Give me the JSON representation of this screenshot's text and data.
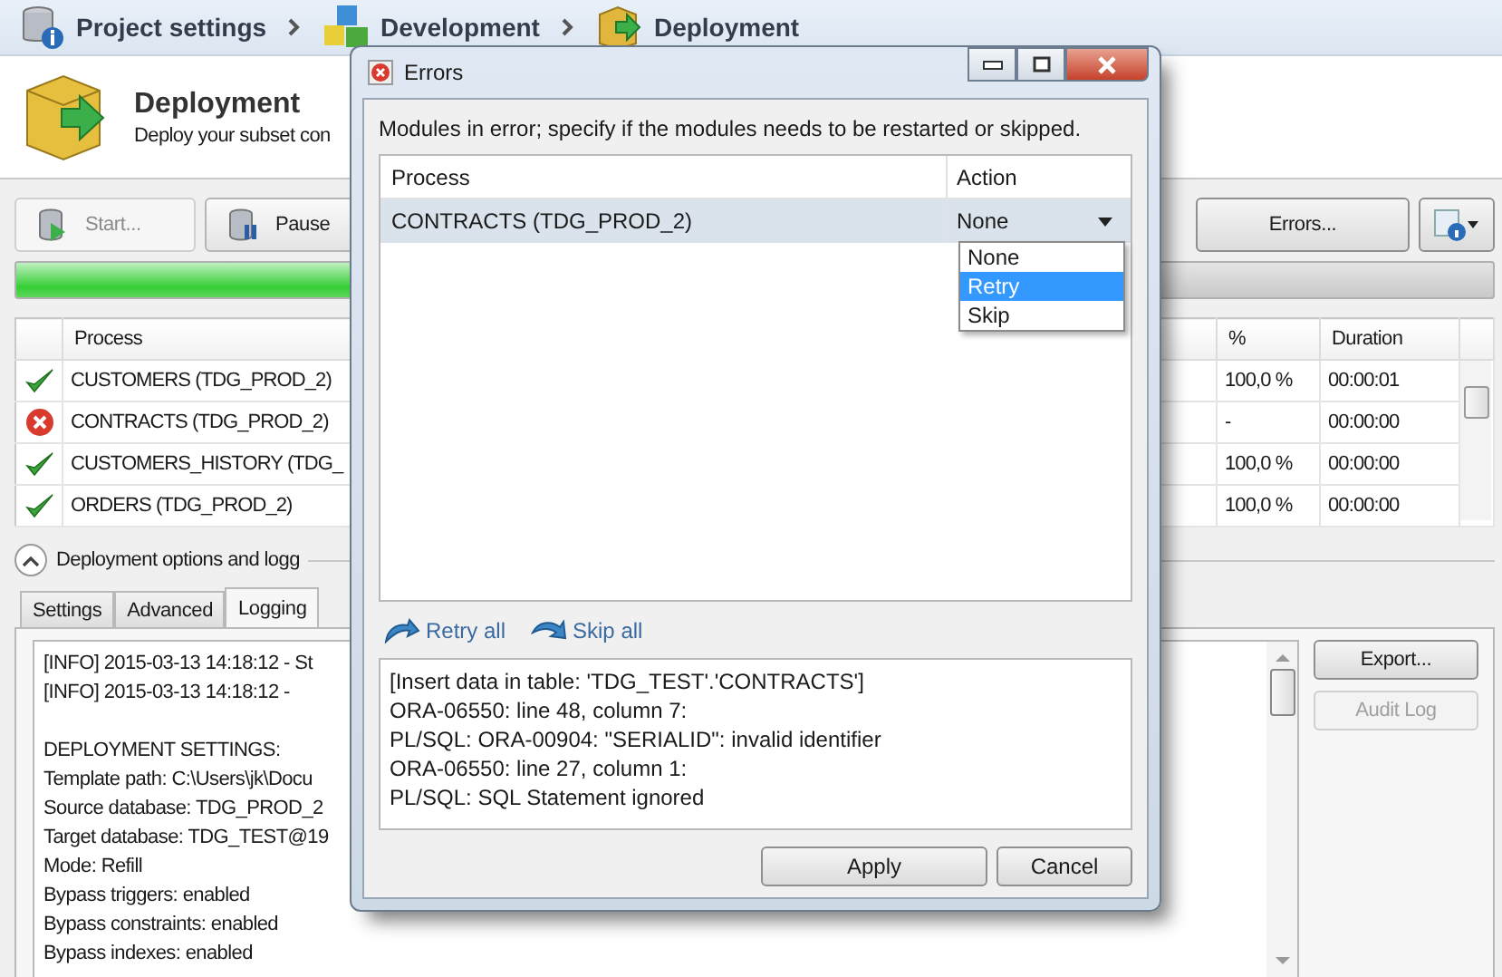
{
  "breadcrumb": [
    {
      "label": "Project settings"
    },
    {
      "label": "Development"
    },
    {
      "label": "Deployment"
    }
  ],
  "header": {
    "title": "Deployment",
    "subtitle": "Deploy your subset con"
  },
  "toolbar": {
    "buttons": [
      {
        "label": "Start...",
        "disabled": true
      },
      {
        "label": "Pause",
        "disabled": false
      }
    ],
    "errors_button": "Errors..."
  },
  "progress": {
    "level": 0.6
  },
  "processes": {
    "columns": {
      "process": "Process",
      "percent": "%",
      "duration": "Duration"
    },
    "rows": [
      {
        "kind": "ok",
        "process": "CUSTOMERS (TDG_PROD_2)",
        "percent": "100,0 %",
        "duration": "00:00:01"
      },
      {
        "kind": "error",
        "process": "CONTRACTS (TDG_PROD_2)",
        "percent": "-",
        "duration": "00:00:00"
      },
      {
        "kind": "ok",
        "process": "CUSTOMERS_HISTORY (TDG_",
        "percent": "100,0 %",
        "duration": "00:00:00"
      },
      {
        "kind": "ok",
        "process": "ORDERS (TDG_PROD_2)",
        "percent": "100,0 %",
        "duration": "00:00:00"
      }
    ]
  },
  "options_expander": {
    "label": "Deployment options and logg",
    "expanded": true
  },
  "tabs": [
    {
      "label": "Settings",
      "selected": false
    },
    {
      "label": "Advanced",
      "selected": false
    },
    {
      "label": "Logging",
      "selected": true
    }
  ],
  "log": {
    "blocks": [
      [
        "[INFO] 2015-03-13 14:18:12 - St",
        "[INFO] 2015-03-13 14:18:12 -"
      ],
      [
        "DEPLOYMENT SETTINGS:",
        "Template path: C:\\Users\\jk\\Docu",
        "Source database: TDG_PROD_2",
        "Target database: TDG_TEST@19",
        "Mode: Refill",
        "Bypass triggers: enabled",
        "Bypass constraints: enabled",
        "Bypass indexes: enabled"
      ]
    ],
    "buttons": [
      {
        "label": "Export...",
        "disabled": false
      },
      {
        "label": "Audit Log",
        "disabled": true
      }
    ]
  },
  "dialog": {
    "title": "Errors",
    "message": "Modules in error; specify if the modules needs to be restarted or skipped.",
    "columns": {
      "process": "Process",
      "action": "Action"
    },
    "rows": [
      {
        "process": "CONTRACTS (TDG_PROD_2)",
        "action": "None",
        "selected": true
      }
    ],
    "dropdown": {
      "options": [
        {
          "label": "None",
          "selected": false
        },
        {
          "label": "Retry",
          "selected": true
        },
        {
          "label": "Skip",
          "selected": false
        }
      ]
    },
    "links": [
      {
        "label": "Retry all",
        "kind": "retry"
      },
      {
        "label": "Skip all",
        "kind": "skip"
      }
    ],
    "details": [
      "[Insert data in table: 'TDG_TEST'.'CONTRACTS']",
      "ORA-06550: line 48, column 7:",
      "PL/SQL: ORA-00904: \"SERIALID\": invalid identifier",
      "ORA-06550: line 27, column 1:",
      "PL/SQL: SQL Statement ignored"
    ],
    "buttons": [
      {
        "label": "Apply",
        "kind": "primary"
      },
      {
        "label": "Cancel",
        "kind": "secondary"
      }
    ]
  }
}
